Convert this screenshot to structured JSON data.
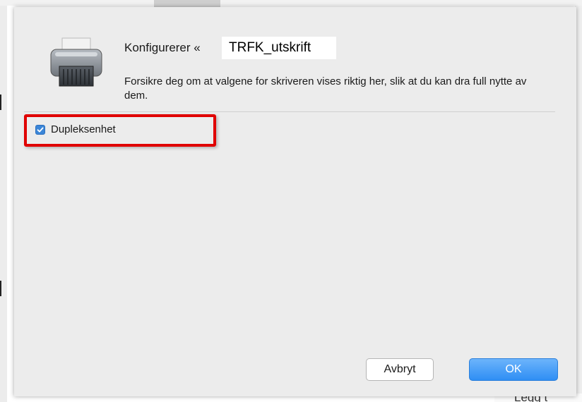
{
  "dialog": {
    "title_prefix": "Konfigurerer «",
    "printer_name": "TRFK_utskrift",
    "description": "Forsikre deg om at valgene for skriveren vises riktig her, slik at du kan dra full nytte av dem.",
    "options": [
      {
        "label": "Dupleksenhet",
        "checked": true
      }
    ],
    "buttons": {
      "cancel": "Avbryt",
      "ok": "OK"
    }
  },
  "background": {
    "bottom_right_text": "Legg t"
  },
  "icons": {
    "printer": "printer-icon",
    "checkmark": "checkmark-icon"
  },
  "colors": {
    "accent": "#3b86d8",
    "ok_button": "#2f8ef4",
    "highlight": "#e00000",
    "dialog_bg": "#ececec"
  }
}
